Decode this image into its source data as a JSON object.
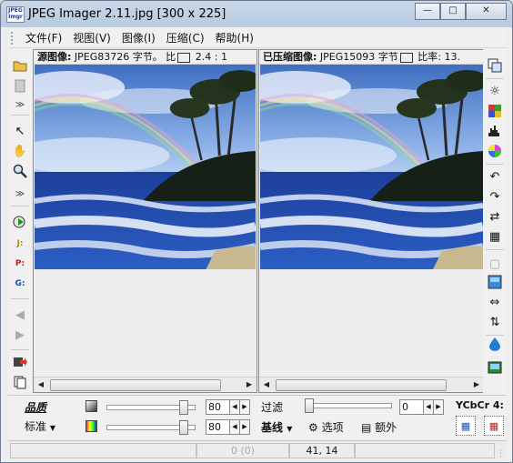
{
  "window": {
    "title": "JPEG Imager 2.11.jpg [300 x 225]"
  },
  "app_icon_text": "JPEG Imager",
  "menu": [
    "文件(F)",
    "视图(V)",
    "图像(I)",
    "压缩(C)",
    "帮助(H)"
  ],
  "left_pane": {
    "label": "源图像:",
    "info": "JPEG83726 字节。 比",
    "ratio": "2.4 : 1"
  },
  "right_pane": {
    "label": "已压缩图像:",
    "info": "JPEG15093 字节",
    "ratio_label": "比率:",
    "ratio": "13."
  },
  "quality": {
    "label": "品质",
    "mode": "标准",
    "value1": "80",
    "value2": "80"
  },
  "filter": {
    "label": "过滤",
    "value": "0"
  },
  "encoding": {
    "mode": "基线",
    "options_label": "选项",
    "extra_label": "额外",
    "color_space": "YCbCr 4:"
  },
  "status": {
    "left": "",
    "middle": "0 (0)",
    "coords": "41, 14",
    "right": ""
  },
  "colors": {
    "titlebar": "#bccde3",
    "sky": "#5b86cf",
    "sea": "#1f48a8"
  }
}
